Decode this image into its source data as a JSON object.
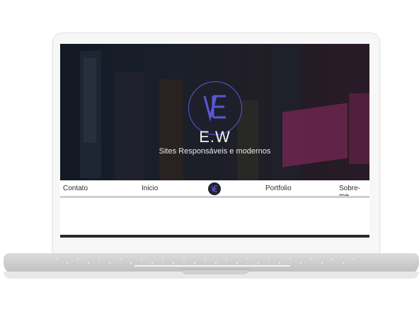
{
  "hero": {
    "brand": "E.W",
    "tagline": "Sites Responsáveis e modernos"
  },
  "nav": {
    "items": [
      "Contato",
      "Inicio",
      "Portfolio",
      "Sobre-me"
    ]
  },
  "colors": {
    "accent": "#5a57d6",
    "logo_bg": "#1f1f2c"
  }
}
